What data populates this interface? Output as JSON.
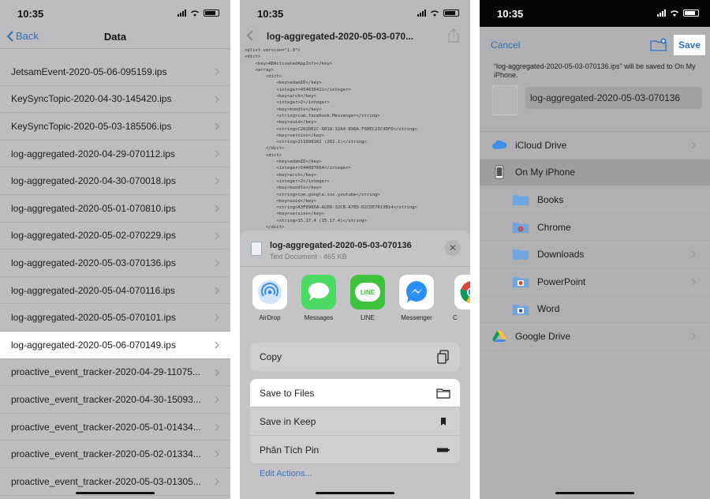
{
  "status": {
    "time": "10:35"
  },
  "panel1": {
    "nav": {
      "back_label": "Back",
      "title": "Data"
    },
    "files": [
      "JetsamEvent-2020-05-06-095159.ips",
      "KeySyncTopic-2020-04-30-145420.ips",
      "KeySyncTopic-2020-05-03-185506.ips",
      "log-aggregated-2020-04-29-070112.ips",
      "log-aggregated-2020-04-30-070018.ips",
      "log-aggregated-2020-05-01-070810.ips",
      "log-aggregated-2020-05-02-070229.ips",
      "log-aggregated-2020-05-03-070136.ips",
      "log-aggregated-2020-05-04-070116.ips",
      "log-aggregated-2020-05-05-070101.ips",
      "log-aggregated-2020-05-06-070149.ips",
      "proactive_event_tracker-2020-04-29-11075...",
      "proactive_event_tracker-2020-04-30-15093...",
      "proactive_event_tracker-2020-05-01-01434...",
      "proactive_event_tracker-2020-05-02-01334...",
      "proactive_event_tracker-2020-05-03-01305..."
    ],
    "selected_file": "log-aggregated-2020-05-06-070149.ips"
  },
  "panel2": {
    "nav_title": "log-aggregated-2020-05-03-070...",
    "xml_lines": [
      "<plist version=\"1.0\">",
      "<dict>",
      "    <key>ADActivatedAppInfo</key>",
      "    <array>",
      "        <dict>",
      "            <key>adamID</key>",
      "            <integer>454638411</integer>",
      "            <key>arch</key>",
      "            <integer>2</integer>",
      "            <key>bundle</key>",
      "            <string>com.facebook.Messenger</string>",
      "            <key>uuid</key>",
      "            <string>C202DE2C-6018-32A4-896A-F60EC23C4DF0</string>",
      "            <key>version</key>",
      "            <string>211898162 (262.1)</string>",
      "        </dict>",
      "        <dict>",
      "            <key>adamID</key>",
      "            <integer>544007664</integer>",
      "            <key>arch</key>",
      "            <integer>2</integer>",
      "            <key>bundle</key>",
      "            <string>com.google.ios.youtube</string>",
      "            <key>uuid</key>",
      "            <string>A3F8965A-ACDD-32CB-A7ED-D2CDE7013B14</string>",
      "            <key>version</key>",
      "            <string>15.17.4 (15.17.4)</string>",
      "        </dict>"
    ],
    "sheet": {
      "file_name": "log-aggregated-2020-05-03-070136",
      "file_meta": "Text Document · 465 KB",
      "close_glyph": "✕"
    },
    "apps": [
      {
        "label": "AirDrop",
        "icon": "airdrop-icon"
      },
      {
        "label": "Messages",
        "icon": "messages-icon"
      },
      {
        "label": "LINE",
        "icon": "line-icon",
        "icon_text": "LINE"
      },
      {
        "label": "Messenger",
        "icon": "messenger-icon"
      },
      {
        "label": "C",
        "icon": "chrome-icon"
      }
    ],
    "actions": {
      "copy": "Copy",
      "save_to_files": "Save to Files",
      "save_in_keep": "Save in Keep",
      "phan_tich_pin": "Phân Tích Pin",
      "edit_actions": "Edit Actions..."
    }
  },
  "panel3": {
    "cancel": "Cancel",
    "save": "Save",
    "message": "“log-aggregated-2020-05-03-070136.ips” will be saved to On My iPhone.",
    "filename": "log-aggregated-2020-05-03-070136",
    "locations": {
      "icloud": "iCloud Drive",
      "on_my_iphone": "On My iPhone",
      "books": "Books",
      "chrome": "Chrome",
      "downloads": "Downloads",
      "powerpoint": "PowerPoint",
      "word": "Word",
      "google_drive": "Google Drive"
    }
  },
  "colors": {
    "ios_blue": "#2f6fb8",
    "line_green": "#3cc23b",
    "messages_green": "#4cd964",
    "messenger_blue": "#2c8ef8"
  }
}
